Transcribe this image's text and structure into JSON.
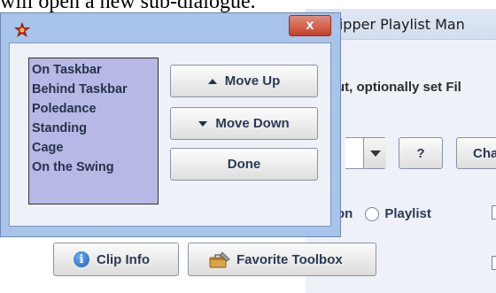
{
  "document": {
    "text": "will open a new sub-dialogue."
  },
  "background_window": {
    "title": "tripper Playlist Man",
    "label": "ut, optionally set Fil",
    "help_button": "?",
    "change_button": "Cha",
    "radio_prefix": "on",
    "radio_playlist": "Playlist"
  },
  "toolbar": {
    "clip_info": "Clip Info",
    "favorite_toolbox": "Favorite Toolbox"
  },
  "dialog": {
    "close_label": "x",
    "list_items": [
      "On Taskbar",
      "Behind Taskbar",
      "Poledance",
      "Standing",
      "Cage",
      "On the Swing"
    ],
    "move_up": "Move Up",
    "move_down": "Move Down",
    "done": "Done"
  },
  "colors": {
    "dialog_frame": "#a9c4ea",
    "listbox": "#b8b8e6",
    "close_button": "#c4402a"
  }
}
